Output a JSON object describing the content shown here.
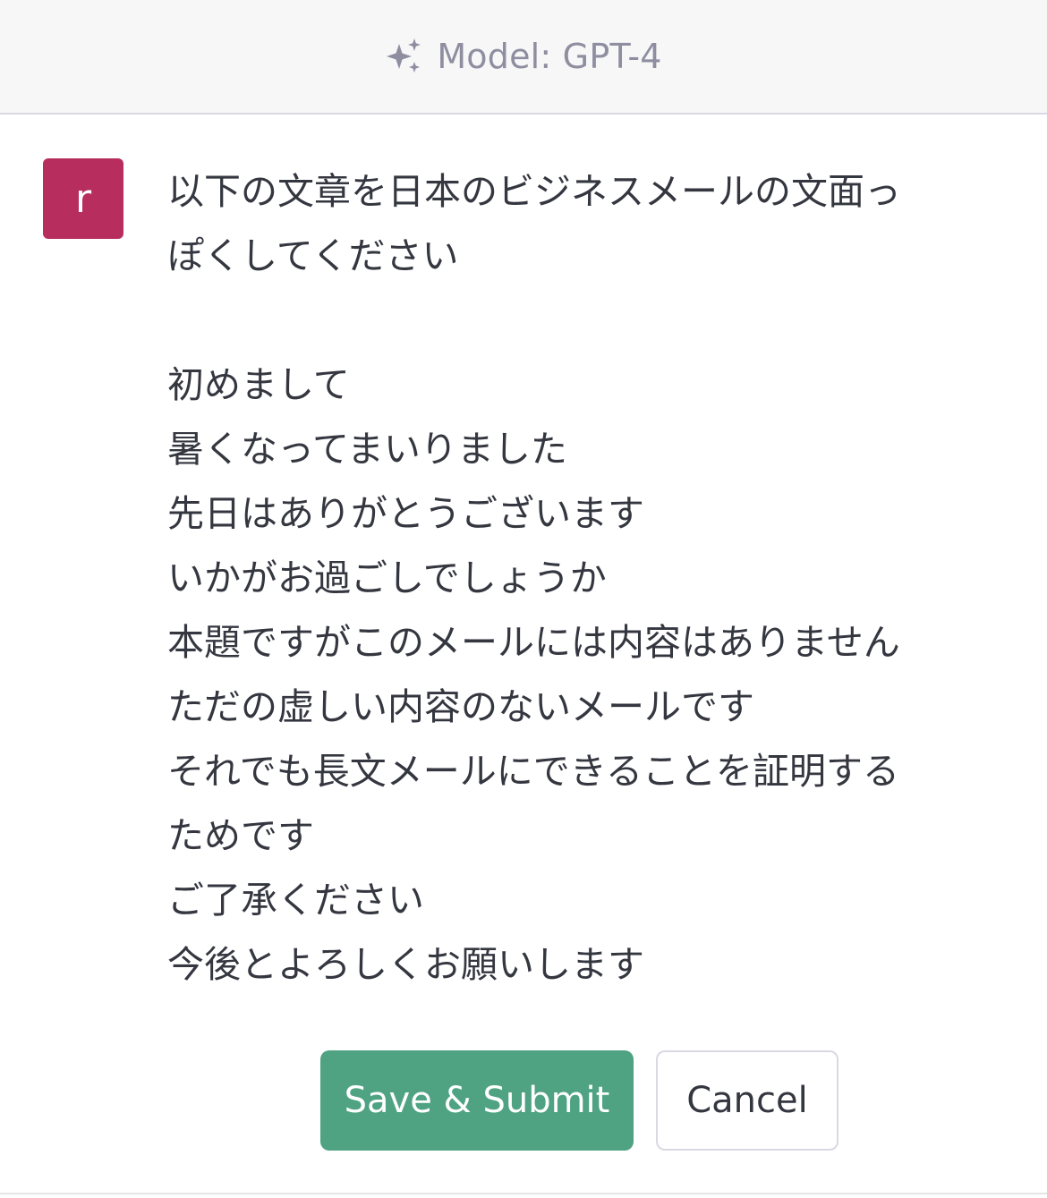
{
  "header": {
    "model_label": "Model: GPT-4",
    "icon": "sparkle-icon"
  },
  "message": {
    "avatar_letter": "r",
    "avatar_color": "#b72e5e",
    "lines": [
      "以下の文章を日本のビジネスメールの文面っ",
      "ぽくしてください",
      "",
      "初めまして",
      "暑くなってまいりました",
      "先日はありがとうございます",
      "いかがお過ごしでしょうか",
      "本題ですがこのメールには内容はありません",
      "ただの虚しい内容のないメールです",
      "それでも長文メールにできることを証明する",
      "ためです",
      "ご了承ください",
      "今後とよろしくお願いします"
    ]
  },
  "actions": {
    "submit_label": "Save & Submit",
    "cancel_label": "Cancel",
    "submit_color": "#4fa383"
  }
}
